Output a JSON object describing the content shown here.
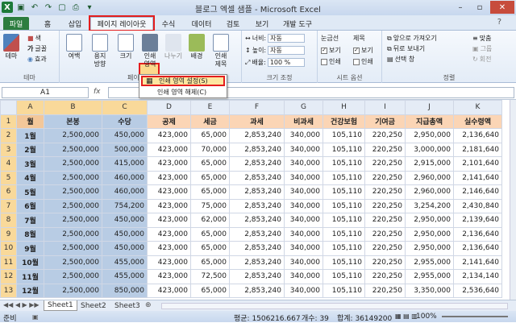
{
  "window": {
    "title": "블로그 엑셀 샘플 - Microsoft Excel"
  },
  "tabs": [
    "파일",
    "홈",
    "삽입",
    "페이지 레이아웃",
    "수식",
    "데이터",
    "검토",
    "보기",
    "개발 도구"
  ],
  "ribbon": {
    "theme": {
      "btn": "테마",
      "items": [
        "색",
        "글꼴",
        "효과"
      ],
      "label": "테마"
    },
    "page": {
      "buttons": [
        "여백",
        "용지\n방향",
        "크기",
        "인쇄\n영역",
        "나누기",
        "배경",
        "인쇄\n제목"
      ],
      "label": "페이"
    },
    "scale": {
      "width_label": "너비:",
      "width_val": "자동",
      "height_label": "높이:",
      "height_val": "자동",
      "scale_label": "배율:",
      "scale_val": "100 %",
      "label": "크기 조정"
    },
    "sheetopts": {
      "gridlines": "눈금선",
      "headings": "제목",
      "view": "보기",
      "print": "인쇄",
      "label": "시트 옵션"
    },
    "arrange": {
      "items": [
        "앞으로 가져오기",
        "뒤로 보내기",
        "선택 창",
        "맞춤",
        "그룹",
        "회전"
      ],
      "label": "정렬"
    }
  },
  "popup": {
    "items": [
      "인쇄 영역 설정(S)",
      "인쇄 영역 해제(C)"
    ]
  },
  "formula": {
    "namebox": "A1",
    "fx": "fx",
    "content": ""
  },
  "columns": [
    "A",
    "B",
    "C",
    "D",
    "E",
    "F",
    "G",
    "H",
    "I",
    "J",
    "K"
  ],
  "headers": [
    "월",
    "본봉",
    "수당",
    "공제",
    "세금",
    "과세",
    "비과세",
    "건강보험",
    "기여금",
    "지급총액",
    "실수령액"
  ],
  "rows": [
    [
      "1월",
      "2,500,000",
      "450,000",
      "423,000",
      "65,000",
      "2,853,240",
      "340,000",
      "105,110",
      "220,250",
      "2,950,000",
      "2,136,640"
    ],
    [
      "2월",
      "2,500,000",
      "500,000",
      "423,000",
      "70,000",
      "2,853,240",
      "340,000",
      "105,110",
      "220,250",
      "3,000,000",
      "2,181,640"
    ],
    [
      "3월",
      "2,500,000",
      "415,000",
      "423,000",
      "65,000",
      "2,853,240",
      "340,000",
      "105,110",
      "220,250",
      "2,915,000",
      "2,101,640"
    ],
    [
      "4월",
      "2,500,000",
      "460,000",
      "423,000",
      "65,000",
      "2,853,240",
      "340,000",
      "105,110",
      "220,250",
      "2,960,000",
      "2,141,640"
    ],
    [
      "5월",
      "2,500,000",
      "460,000",
      "423,000",
      "65,000",
      "2,853,240",
      "340,000",
      "105,110",
      "220,250",
      "2,960,000",
      "2,146,640"
    ],
    [
      "6월",
      "2,500,000",
      "754,200",
      "423,000",
      "75,000",
      "2,853,240",
      "340,000",
      "105,110",
      "220,250",
      "3,254,200",
      "2,430,840"
    ],
    [
      "7월",
      "2,500,000",
      "450,000",
      "423,000",
      "62,000",
      "2,853,240",
      "340,000",
      "105,110",
      "220,250",
      "2,950,000",
      "2,139,640"
    ],
    [
      "8월",
      "2,500,000",
      "450,000",
      "423,000",
      "65,000",
      "2,853,240",
      "340,000",
      "105,110",
      "220,250",
      "2,950,000",
      "2,136,640"
    ],
    [
      "9월",
      "2,500,000",
      "450,000",
      "423,000",
      "65,000",
      "2,853,240",
      "340,000",
      "105,110",
      "220,250",
      "2,950,000",
      "2,136,640"
    ],
    [
      "10월",
      "2,500,000",
      "455,000",
      "423,000",
      "65,000",
      "2,853,240",
      "340,000",
      "105,110",
      "220,250",
      "2,955,000",
      "2,141,640"
    ],
    [
      "11월",
      "2,500,000",
      "455,000",
      "423,000",
      "72,500",
      "2,853,240",
      "340,000",
      "105,110",
      "220,250",
      "2,955,000",
      "2,134,140"
    ],
    [
      "12월",
      "2,500,000",
      "850,000",
      "423,000",
      "65,000",
      "2,853,240",
      "340,000",
      "105,110",
      "220,250",
      "3,350,000",
      "2,536,640"
    ]
  ],
  "rownums": [
    "1",
    "2",
    "3",
    "4",
    "5",
    "6",
    "7",
    "8",
    "9",
    "10",
    "11",
    "12",
    "13"
  ],
  "sheets": [
    "Sheet1",
    "Sheet2",
    "Sheet3"
  ],
  "status": {
    "ready": "준비",
    "average": "평균: 1506216.667",
    "count": "개수: 39",
    "sum": "합계: 36149200",
    "zoom": "100%"
  }
}
